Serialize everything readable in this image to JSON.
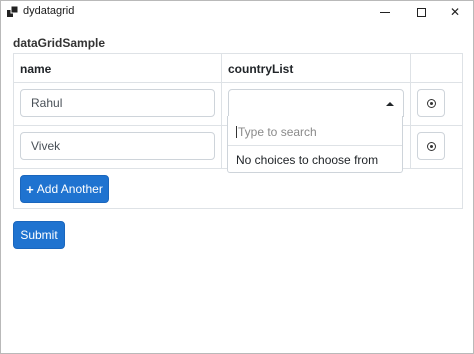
{
  "window": {
    "title": "dydatagrid",
    "controls": {
      "minimize": "minimize",
      "maximize": "maximize",
      "close": "✕"
    }
  },
  "form": {
    "grid_label": "dataGridSample",
    "columns": [
      "name",
      "countryList"
    ],
    "rows": [
      {
        "name": "Rahul",
        "country": ""
      },
      {
        "name": "Vivek",
        "country": ""
      }
    ],
    "dropdown": {
      "search_placeholder": "Type to search",
      "empty_message": "No choices to choose from"
    },
    "add_button_label": "Add Another",
    "submit_label": "Submit"
  },
  "colors": {
    "primary": "#1f73d0",
    "border": "#dee2e6",
    "input_border": "#ced4da"
  },
  "icons": {
    "app": "app-icon",
    "remove": "remove-circle-icon",
    "add": "plus-icon",
    "caret": "caret-up-icon"
  }
}
